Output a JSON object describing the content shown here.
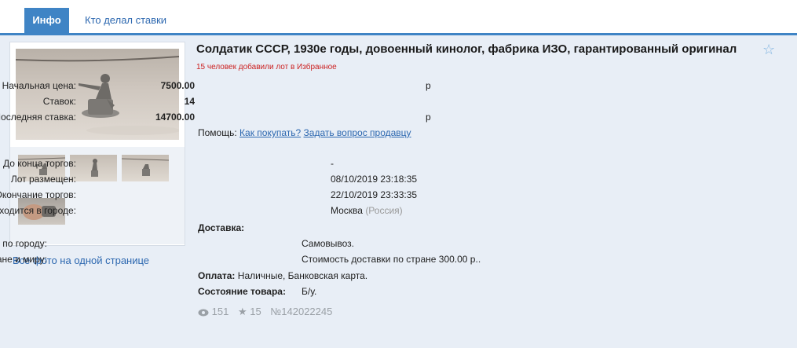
{
  "tabs": [
    {
      "label": "Инфо",
      "active": true
    },
    {
      "label": "Кто делал ставки",
      "active": false
    }
  ],
  "lot": {
    "title": "Солдатик СССР, 1930е годы, довоенный кинолог, фабрика ИЗО, гарантированный оригинал",
    "favorites_note": "15 человек добавили лот в Избранное"
  },
  "prices": {
    "start_label": "Начальная цена:",
    "start_value": "7500.00",
    "start_currency": "р",
    "bids_label": "Ставок:",
    "bids_value": "14",
    "last_label": "Последняя ставка:",
    "last_value": "14700.00",
    "last_currency": "р"
  },
  "help": {
    "label": "Помощь:",
    "how_to_buy": "Как покупать?",
    "ask_seller": "Задать вопрос продавцу"
  },
  "timing": {
    "ends_in_label": "До конца торгов:",
    "ends_in_value": "-",
    "posted_label": "Лот размещен:",
    "posted_value": "08/10/2019 23:18:35",
    "end_label": "Окончание торгов:",
    "end_value": "22/10/2019 23:33:35",
    "city_label": "Лот находится в городе:",
    "city_value": "Москва",
    "country_value": "(Россия)"
  },
  "delivery": {
    "title": "Доставка:",
    "city_label": "по городу:",
    "city_value": "Самовывоз.",
    "country_label": "по стране и миру:",
    "country_value": "Стоимость доставки по стране 300.00 р.."
  },
  "payment": {
    "label": "Оплата:",
    "value": "Наличные, Банковская карта."
  },
  "condition": {
    "label": "Состояние товара:",
    "value": "Б/у."
  },
  "stats": {
    "views": "151",
    "favorites": "15",
    "lot_number": "№142022245"
  },
  "photos": {
    "all_photos_link": "Все фото на одной странице"
  },
  "colors": {
    "accent": "#3f84c5",
    "link": "#2d68b0",
    "panel_bg": "#e8eef6",
    "favorites_note": "#cc2222"
  }
}
